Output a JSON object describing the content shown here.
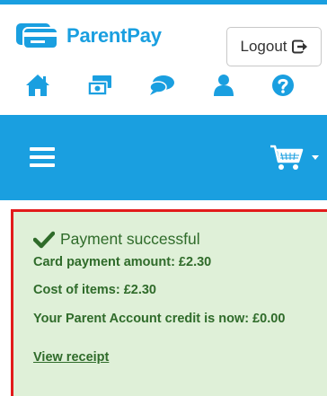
{
  "brand": {
    "name": "ParentPay",
    "color": "#1a9fe0"
  },
  "header": {
    "logout_label": "Logout"
  },
  "iconbar": {
    "items": [
      "home-icon",
      "payments-icon",
      "messages-icon",
      "account-icon",
      "help-icon"
    ]
  },
  "navbar": {
    "menu_icon": "hamburger-menu-icon",
    "cart_icon": "shopping-cart-icon"
  },
  "alert": {
    "title": "Payment successful",
    "card_amount": "Card payment amount: £2.30",
    "cost_of_items": "Cost of items: £2.30",
    "credit": "Your Parent Account credit is now: £0.00",
    "receipt_link": "View receipt",
    "colors": {
      "background": "#dff0d8",
      "text": "#2f6b2a",
      "highlight_border": "#e21b1b"
    }
  }
}
